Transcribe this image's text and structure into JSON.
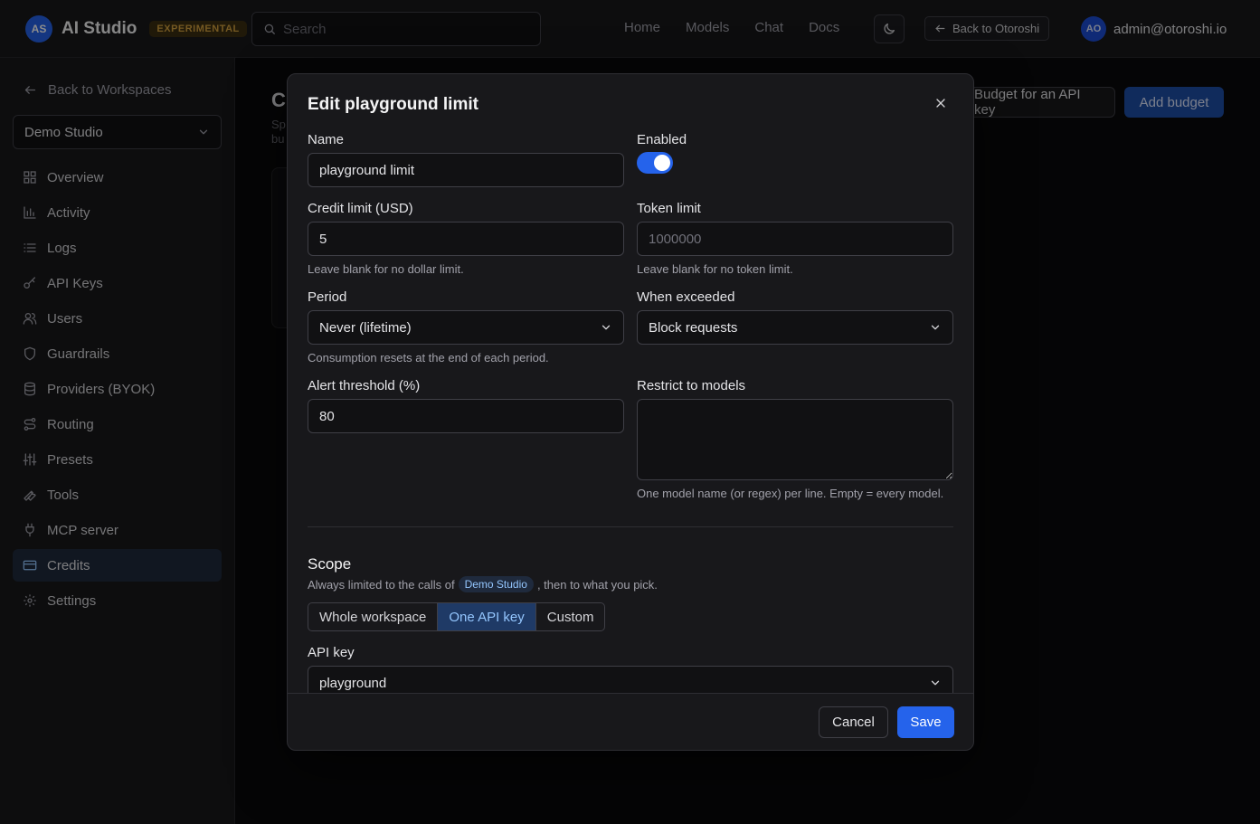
{
  "topbar": {
    "brand_initials": "AS",
    "brand_name": "AI Studio",
    "brand_badge": "EXPERIMENTAL",
    "search_placeholder": "Search",
    "nav": [
      "Home",
      "Models",
      "Chat",
      "Docs"
    ],
    "back_label": "Back to Otoroshi",
    "user_initials": "AO",
    "user_email": "admin@otoroshi.io"
  },
  "sidebar": {
    "back_label": "Back to Workspaces",
    "workspace": "Demo Studio",
    "items": [
      {
        "label": "Overview",
        "icon": "grid-icon"
      },
      {
        "label": "Activity",
        "icon": "bar-chart-icon"
      },
      {
        "label": "Logs",
        "icon": "list-icon"
      },
      {
        "label": "API Keys",
        "icon": "key-icon"
      },
      {
        "label": "Users",
        "icon": "users-icon"
      },
      {
        "label": "Guardrails",
        "icon": "shield-icon"
      },
      {
        "label": "Providers (BYOK)",
        "icon": "database-icon"
      },
      {
        "label": "Routing",
        "icon": "route-icon"
      },
      {
        "label": "Presets",
        "icon": "sliders-icon"
      },
      {
        "label": "Tools",
        "icon": "wrench-icon"
      },
      {
        "label": "MCP server",
        "icon": "plug-icon"
      },
      {
        "label": "Credits",
        "icon": "credit-card-icon",
        "active": true
      },
      {
        "label": "Settings",
        "icon": "gear-icon"
      }
    ]
  },
  "page": {
    "title_fragment": "C",
    "sub_fragment": "Sp bu",
    "budget_api_key_label": "Budget for an API key",
    "add_budget_label": "Add budget"
  },
  "modal": {
    "title": "Edit playground limit",
    "name_label": "Name",
    "name_value": "playground limit",
    "enabled_label": "Enabled",
    "enabled": true,
    "credit_label": "Credit limit (USD)",
    "credit_value": "5",
    "credit_help": "Leave blank for no dollar limit.",
    "token_label": "Token limit",
    "token_placeholder": "1000000",
    "token_help": "Leave blank for no token limit.",
    "period_label": "Period",
    "period_value": "Never (lifetime)",
    "period_help": "Consumption resets at the end of each period.",
    "exceeded_label": "When exceeded",
    "exceeded_value": "Block requests",
    "alert_label": "Alert threshold (%)",
    "alert_value": "80",
    "restrict_label": "Restrict to models",
    "restrict_help": "One model name (or regex) per line. Empty = every model.",
    "scope_title": "Scope",
    "scope_desc_before": "Always limited to the calls of",
    "scope_workspace": "Demo Studio",
    "scope_desc_after": ", then to what you pick.",
    "scope_options": [
      "Whole workspace",
      "One API key",
      "Custom"
    ],
    "scope_selected": "One API key",
    "api_key_label": "API key",
    "api_key_value": "playground",
    "cancel_label": "Cancel",
    "save_label": "Save"
  },
  "colors": {
    "accent": "#2563eb",
    "badge": "#d6a23e",
    "background": "#0a0a0b",
    "panel": "#18181b"
  }
}
